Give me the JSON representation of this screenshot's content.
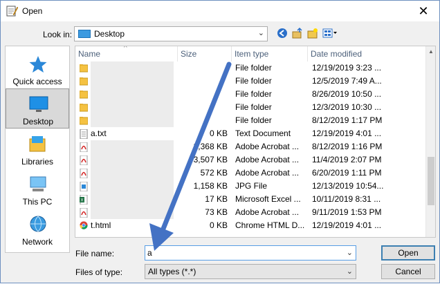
{
  "window": {
    "title": "Open",
    "close_glyph": "✕"
  },
  "lookin": {
    "label": "Look in:",
    "value": "Desktop"
  },
  "places": [
    {
      "label": "Quick access",
      "icon": "star-icon"
    },
    {
      "label": "Desktop",
      "icon": "desktop-icon"
    },
    {
      "label": "Libraries",
      "icon": "libraries-icon"
    },
    {
      "label": "This PC",
      "icon": "computer-icon"
    },
    {
      "label": "Network",
      "icon": "network-icon"
    }
  ],
  "columns": {
    "name": "Name",
    "size": "Size",
    "type": "Item type",
    "date": "Date modified"
  },
  "files": [
    {
      "name": "",
      "size": "",
      "type": "File folder",
      "date": "12/19/2019 3:23 ...",
      "icon": "folder-icon"
    },
    {
      "name": "",
      "size": "",
      "type": "File folder",
      "date": "12/5/2019 7:49 A...",
      "icon": "folder-icon"
    },
    {
      "name": "",
      "size": "",
      "type": "File folder",
      "date": "8/26/2019 10:50 ...",
      "icon": "folder-icon"
    },
    {
      "name": "",
      "size": "",
      "type": "File folder",
      "date": "12/3/2019 10:30 ...",
      "icon": "folder-icon"
    },
    {
      "name": "",
      "size": "",
      "type": "File folder",
      "date": "8/12/2019 1:17 PM",
      "icon": "folder-icon"
    },
    {
      "name": "a.txt",
      "size": "0 KB",
      "type": "Text Document",
      "date": "12/19/2019 4:01 ...",
      "icon": "text-file-icon"
    },
    {
      "name": "",
      "size": "2,368 KB",
      "type": "Adobe Acrobat ...",
      "date": "8/12/2019 1:16 PM",
      "icon": "pdf-icon"
    },
    {
      "name": "",
      "size": "3,507 KB",
      "type": "Adobe Acrobat ...",
      "date": "11/4/2019 2:07 PM",
      "icon": "pdf-icon"
    },
    {
      "name": "",
      "size": "572 KB",
      "type": "Adobe Acrobat ...",
      "date": "6/20/2019 1:11 PM",
      "icon": "pdf-icon"
    },
    {
      "name": "",
      "size": "1,158 KB",
      "type": "JPG File",
      "date": "12/13/2019 10:54...",
      "icon": "image-file-icon"
    },
    {
      "name": "",
      "size": "17 KB",
      "type": "Microsoft Excel ...",
      "date": "10/11/2019 8:31 ...",
      "icon": "excel-icon"
    },
    {
      "name": "",
      "size": "73 KB",
      "type": "Adobe Acrobat ...",
      "date": "9/11/2019 1:53 PM",
      "icon": "pdf-icon"
    },
    {
      "name": "t.html",
      "size": "0 KB",
      "type": "Chrome HTML D...",
      "date": "12/19/2019 4:01 ...",
      "icon": "chrome-icon"
    }
  ],
  "filename": {
    "label": "File name:",
    "value": "a"
  },
  "filetype": {
    "label": "Files of type:",
    "value": "All types (*.*)"
  },
  "buttons": {
    "open": "Open",
    "cancel": "Cancel"
  },
  "colors": {
    "accent": "#3c7fb1",
    "arrow": "#4472c4"
  }
}
